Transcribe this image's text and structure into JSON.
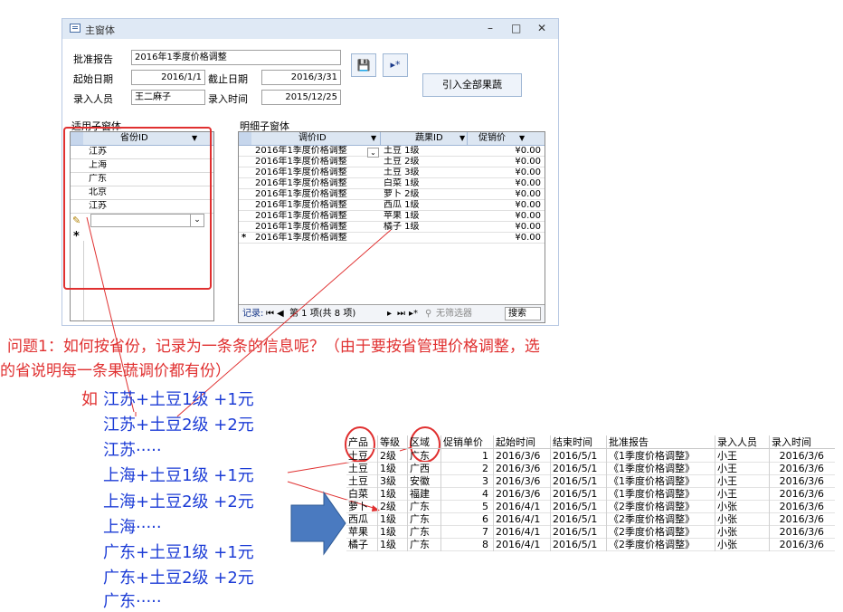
{
  "window": {
    "title": "主窗体",
    "minimize": "–",
    "maximize": "□",
    "close": "✕"
  },
  "form": {
    "approve_label": "批准报告",
    "approve_value": "2016年1季度价格调整",
    "start_label": "起始日期",
    "start_value": "2016/1/1",
    "end_label": "截止日期",
    "end_value": "2016/3/31",
    "entry_person_label": "录入人员",
    "entry_person_value": "王二麻子",
    "entry_time_label": "录入时间",
    "entry_time_value": "2015/12/25",
    "import_all_button": "引入全部果蔬",
    "save_icon_glyph": "💾",
    "new_record_glyph": "▸*"
  },
  "apply_subform": {
    "title": "适用子窗体",
    "column": "省份ID",
    "rows": [
      "江苏",
      "上海",
      "广东",
      "北京",
      "江苏"
    ],
    "new_row_marker": "*",
    "edit_marker": "✎"
  },
  "detail_subform": {
    "title": "明细子窗体",
    "columns": [
      "调价ID",
      "蔬果ID",
      "促销价"
    ],
    "rows": [
      [
        "2016年1季度价格调整",
        "土豆 1级",
        "¥0.00"
      ],
      [
        "2016年1季度价格调整",
        "土豆 2级",
        "¥0.00"
      ],
      [
        "2016年1季度价格调整",
        "土豆 3级",
        "¥0.00"
      ],
      [
        "2016年1季度价格调整",
        "白菜 1级",
        "¥0.00"
      ],
      [
        "2016年1季度价格调整",
        "萝卜 2级",
        "¥0.00"
      ],
      [
        "2016年1季度价格调整",
        "西瓜 1级",
        "¥0.00"
      ],
      [
        "2016年1季度价格调整",
        "苹果 1级",
        "¥0.00"
      ],
      [
        "2016年1季度价格调整",
        "橘子 1级",
        "¥0.00"
      ]
    ],
    "new_row": [
      "2016年1季度价格调整",
      "",
      "¥0.00"
    ],
    "nav_record_label": "记录:",
    "nav_position": "第 1 项(共 8 项)",
    "nav_filter": "无筛选器",
    "nav_search": "搜索"
  },
  "question": {
    "line1": "问题1：如何按省份，记录为一条条的信息呢？（由于要按省管理价格调整，选",
    "line2": "的省说明每一条果蔬调价都有份）"
  },
  "examples": {
    "lead": "如",
    "lines": [
      "江苏+土豆1级 +1元",
      "江苏+土豆2级  +2元",
      "江苏·····",
      "上海+土豆1级 +1元",
      "上海+土豆2级  +2元",
      "上海·····",
      "广东+土豆1级 +1元",
      "广东+土豆2级  +2元",
      "广东·····"
    ]
  },
  "result_table": {
    "headers": [
      "产品",
      "等级",
      "区域",
      "促销单价",
      "起始时间",
      "结束时间",
      "批准报告",
      "录入人员",
      "录入时间"
    ],
    "rows": [
      [
        "土豆",
        "2级",
        "广东",
        "1",
        "2016/3/6",
        "2016/5/1",
        "《1季度价格调整》",
        "小王",
        "2016/3/6"
      ],
      [
        "土豆",
        "1级",
        "广西",
        "2",
        "2016/3/6",
        "2016/5/1",
        "《1季度价格调整》",
        "小王",
        "2016/3/6"
      ],
      [
        "土豆",
        "3级",
        "安徽",
        "3",
        "2016/3/6",
        "2016/5/1",
        "《1季度价格调整》",
        "小王",
        "2016/3/6"
      ],
      [
        "白菜",
        "1级",
        "福建",
        "4",
        "2016/3/6",
        "2016/5/1",
        "《1季度价格调整》",
        "小王",
        "2016/3/6"
      ],
      [
        "萝卜",
        "2级",
        "广东",
        "5",
        "2016/4/1",
        "2016/5/1",
        "《2季度价格调整》",
        "小张",
        "2016/3/6"
      ],
      [
        "西瓜",
        "1级",
        "广东",
        "6",
        "2016/4/1",
        "2016/5/1",
        "《2季度价格调整》",
        "小张",
        "2016/3/6"
      ],
      [
        "苹果",
        "1级",
        "广东",
        "7",
        "2016/4/1",
        "2016/5/1",
        "《2季度价格调整》",
        "小张",
        "2016/3/6"
      ],
      [
        "橘子",
        "1级",
        "广东",
        "8",
        "2016/4/1",
        "2016/5/1",
        "《2季度价格调整》",
        "小张",
        "2016/3/6"
      ]
    ]
  },
  "colors": {
    "annotation_red": "#e03030",
    "example_blue": "#1c3cd6",
    "arrow_blue": "#3e6fb4"
  }
}
